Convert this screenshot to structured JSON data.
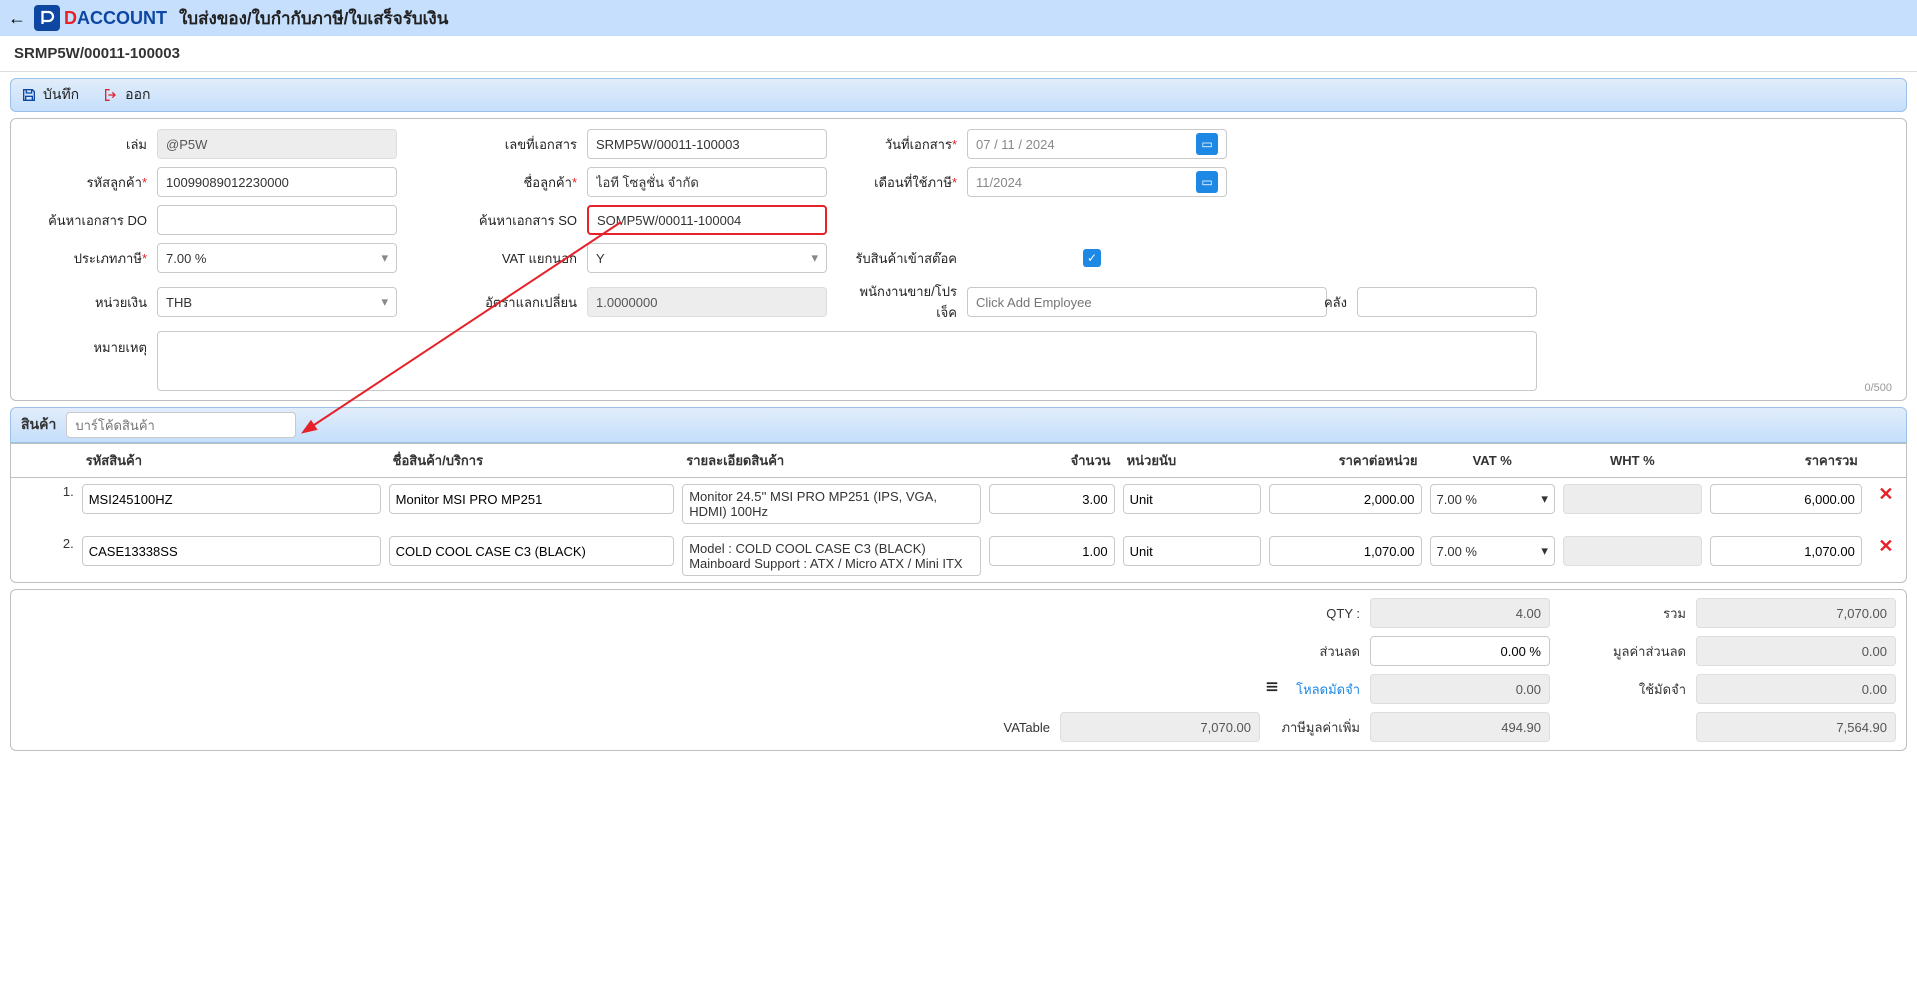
{
  "header": {
    "brand_d": "D",
    "brand_rest": "ACCOUNT",
    "page_title": "ใบส่งของ/ใบกำกับภาษี/ใบเสร็จรับเงิน"
  },
  "subheader": {
    "doc_no": "SRMP5W/00011-100003"
  },
  "toolbar": {
    "save": "บันทึก",
    "exit": "ออก"
  },
  "form": {
    "book_label": "เล่ม",
    "book_value": "@P5W",
    "doc_no_label": "เลขที่เอกสาร",
    "doc_no_value": "SRMP5W/00011-100003",
    "doc_date_label": "วันที่เอกสาร",
    "doc_date_value": "07 / 11 / 2024",
    "cust_code_label": "รหัสลูกค้า",
    "cust_code_value": "10099089012230000",
    "cust_name_label": "ชื่อลูกค้า",
    "cust_name_value": "ไอที โซลูชั่น จำกัด",
    "period_label": "เดือนที่ใช้ภาษี",
    "period_value": "11/2024",
    "do_search_label": "ค้นหาเอกสาร DO",
    "so_search_label": "ค้นหาเอกสาร SO",
    "so_search_value": "SOMP5W/00011-100004",
    "tax_type_label": "ประเภทภาษี",
    "tax_type_value": "7.00 %",
    "vat_sep_label": "VAT แยกนอก",
    "vat_sep_value": "Y",
    "recv_stock_label": "รับสินค้าเข้าสต๊อค",
    "currency_label": "หน่วยเงิน",
    "currency_value": "THB",
    "exchange_label": "อัตราแลกเปลี่ยน",
    "exchange_value": "1.0000000",
    "sales_label": "พนักงานขาย/โปรเจ็ค",
    "sales_placeholder": "Click Add Employee",
    "warehouse_label": "คลัง",
    "remark_label": "หมายเหตุ",
    "char_count": "0/500"
  },
  "items_section": {
    "title": "สินค้า",
    "barcode_placeholder": "บาร์โค้ดสินค้า",
    "columns": {
      "code": "รหัสสินค้า",
      "name": "ชื่อสินค้า/บริการ",
      "detail": "รายละเอียดสินค้า",
      "qty": "จำนวน",
      "unit": "หน่วยนับ",
      "price": "ราคาต่อหน่วย",
      "vat": "VAT %",
      "wht": "WHT %",
      "total": "ราคารวม"
    },
    "rows": [
      {
        "no": "1.",
        "code": "MSI245100HZ",
        "name": "Monitor MSI PRO MP251",
        "detail": "Monitor 24.5'' MSI PRO MP251 (IPS, VGA, HDMI) 100Hz",
        "qty": "3.00",
        "unit": "Unit",
        "price": "2,000.00",
        "vat": "7.00 %",
        "wht": "",
        "total": "6,000.00"
      },
      {
        "no": "2.",
        "code": "CASE13338SS",
        "name": "COLD COOL CASE C3 (BLACK)",
        "detail": "Model : COLD COOL CASE C3 (BLACK)\nMainboard Support : ATX / Micro ATX / Mini ITX",
        "qty": "1.00",
        "unit": "Unit",
        "price": "1,070.00",
        "vat": "7.00 %",
        "wht": "",
        "total": "1,070.00"
      }
    ]
  },
  "summary": {
    "qty_label": "QTY :",
    "qty_value": "4.00",
    "sum_label": "รวม",
    "sum_value": "7,070.00",
    "discount_label": "ส่วนลด",
    "discount_value": "0.00 %",
    "discount_amount_label": "มูลค่าส่วนลด",
    "discount_amount_value": "0.00",
    "load_deposit_label": "โหลดมัดจำ",
    "load_deposit_value": "0.00",
    "use_deposit_label": "ใช้มัดจำ",
    "use_deposit_value": "0.00",
    "vatable_label": "VATable",
    "vatable_value": "7,070.00",
    "vat_amount_label": "ภาษีมูลค่าเพิ่ม",
    "vat_amount_value": "494.90",
    "grand_total_value": "7,564.90"
  }
}
